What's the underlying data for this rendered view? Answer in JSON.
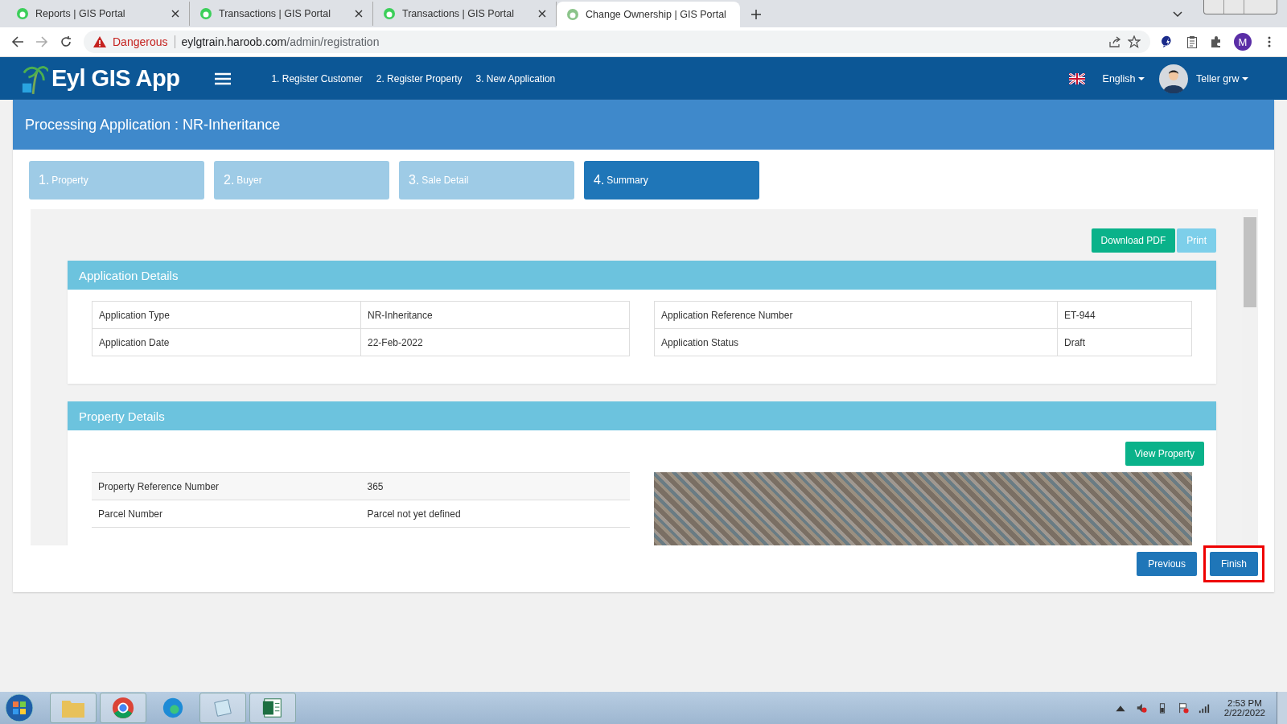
{
  "browser": {
    "tabs": [
      {
        "title": "Reports | GIS Portal",
        "selected": false
      },
      {
        "title": "Transactions | GIS Portal",
        "selected": false
      },
      {
        "title": "Transactions | GIS Portal",
        "selected": false
      },
      {
        "title": "Change Ownership | GIS Portal",
        "selected": true
      }
    ],
    "security": "Dangerous",
    "url_host": "eylgtrain.haroob.com",
    "url_path": "/admin/registration",
    "profile_initial": "M"
  },
  "app": {
    "logo": "Eyl GIS App",
    "menu": [
      "1. Register Customer",
      "2. Register Property",
      "3. New Application"
    ],
    "language": "English",
    "user": "Teller grw"
  },
  "page_title": "Processing Application : NR-Inheritance",
  "steps": [
    {
      "number": "1.",
      "label": "Property",
      "selected": false
    },
    {
      "number": "2.",
      "label": "Buyer",
      "selected": false
    },
    {
      "number": "3.",
      "label": "Sale Detail",
      "selected": false
    },
    {
      "number": "4.",
      "label": "Summary",
      "selected": true
    }
  ],
  "actions": [
    {
      "label": "Download PDF",
      "kind": "success"
    },
    {
      "label": "Print",
      "kind": "info"
    }
  ],
  "application_details": {
    "title": "Application Details",
    "left": [
      {
        "label": "Application Type",
        "value": "NR-Inheritance"
      },
      {
        "label": "Application Date",
        "value": "22-Feb-2022"
      }
    ],
    "right": [
      {
        "label": "Application Reference Number",
        "value": "ET-944"
      },
      {
        "label": "Application Status",
        "value": "Draft"
      }
    ]
  },
  "property_details": {
    "title": "Property Details",
    "button": "View Property",
    "rows": [
      {
        "label": "Property Reference Number",
        "value": "365"
      },
      {
        "label": "Parcel Number",
        "value": "Parcel not yet defined"
      }
    ]
  },
  "nav_buttons": [
    {
      "label": "Previous",
      "highlighted": false
    },
    {
      "label": "Finish",
      "highlighted": true
    }
  ],
  "taskbar": {
    "time": "2:53 PM",
    "date": "2/22/2022"
  }
}
